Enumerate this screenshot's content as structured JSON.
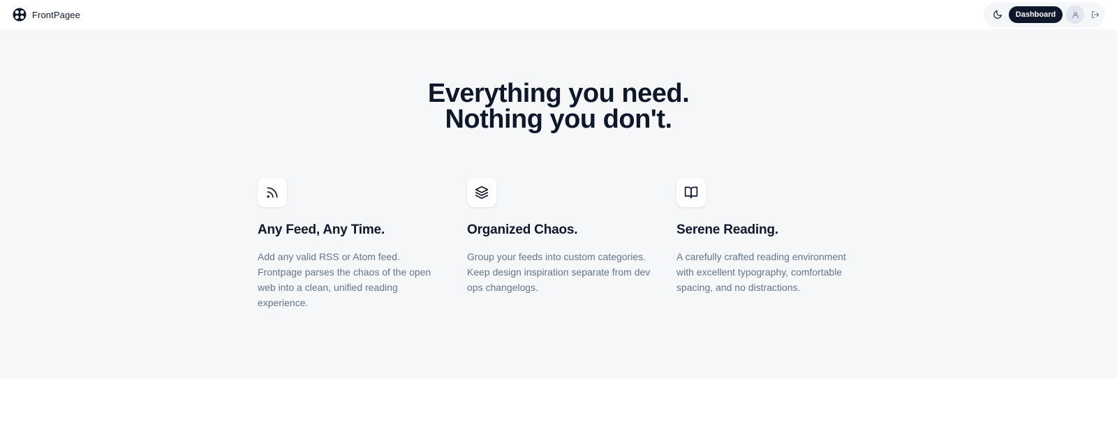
{
  "navbar": {
    "brand_name": "FrontPagee",
    "dashboard_label": "Dashboard",
    "icons": {
      "logo": "frontpage-logo-icon",
      "theme": "moon-icon",
      "avatar": "user-icon",
      "logout": "log-out-icon"
    }
  },
  "hero": {
    "title_line1": "Everything you need.",
    "title_line2": "Nothing you don't."
  },
  "features": [
    {
      "icon": "rss-icon",
      "title": "Any Feed, Any Time.",
      "description": "Add any valid RSS or Atom feed. Frontpage parses the chaos of the open web into a clean, unified reading experience."
    },
    {
      "icon": "layers-icon",
      "title": "Organized Chaos.",
      "description": "Group your feeds into custom categories. Keep design inspiration separate from dev ops changelogs."
    },
    {
      "icon": "book-open-icon",
      "title": "Serene Reading.",
      "description": "A carefully crafted reading environment with excellent typography, comfortable spacing, and no distractions."
    }
  ],
  "colors": {
    "primary": "#0f172a",
    "muted_text": "#64748b",
    "hero_background": "#f6f7f9",
    "page_background": "#ffffff"
  }
}
